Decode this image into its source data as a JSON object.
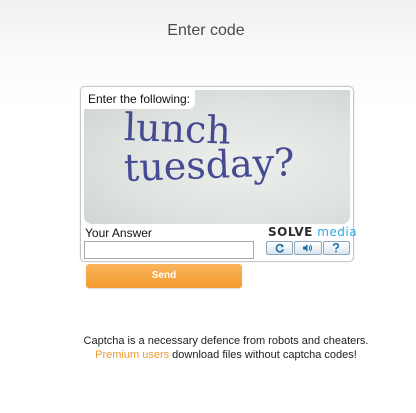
{
  "page": {
    "title": "Enter code"
  },
  "captcha": {
    "instruction": "Enter the following:",
    "text_line1": "lunch",
    "text_line2": "tuesday?",
    "answer_label": "Your Answer",
    "answer_value": "",
    "brand_solve": "SOLVE",
    "brand_media": "media",
    "buttons": [
      {
        "icon": "refresh-icon"
      },
      {
        "icon": "audio-icon"
      },
      {
        "icon": "help-icon"
      }
    ]
  },
  "send": {
    "label": "Send"
  },
  "footer": {
    "line1": "Captcha is a necessary defence from robots and cheaters.",
    "premium_link": "Premium users",
    "line2_rest": " download files without captcha codes!"
  },
  "colors": {
    "accent_orange": "#f29a2e",
    "captcha_text": "#454a93",
    "brand_blue": "#31a7e4"
  }
}
